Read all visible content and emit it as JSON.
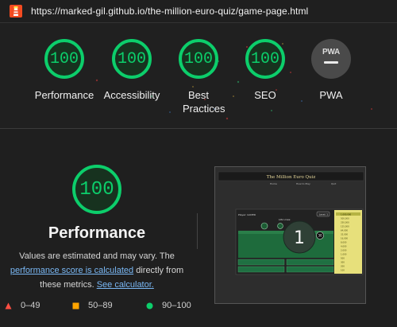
{
  "browser": {
    "url": "https://marked-gil.github.io/the-million-euro-quiz/game-page.html",
    "logo_icon": "lighthouse-icon"
  },
  "categories": [
    {
      "label": "Performance",
      "score": "100"
    },
    {
      "label": "Accessibility",
      "score": "100"
    },
    {
      "label": "Best Practices",
      "score": "100"
    },
    {
      "label": "SEO",
      "score": "100"
    },
    {
      "label": "PWA",
      "badge": "PWA",
      "icon": "pwa-badge-icon"
    }
  ],
  "detail": {
    "score": "100",
    "title": "Performance",
    "desc_prefix": "Values are estimated and may vary. The",
    "desc_link1": "performance score is calculated",
    "desc_middle": "directly from these metrics.",
    "desc_link2": "See calculator."
  },
  "legend": [
    {
      "range": "0–49",
      "color": "#ff4e42",
      "icon": "triangle-icon"
    },
    {
      "range": "50–89",
      "color": "#ffa400",
      "icon": "square-icon"
    },
    {
      "range": "90–100",
      "color": "#0cce6b",
      "icon": "circle-icon"
    }
  ],
  "screenshot": {
    "site_title": "The Million Euro Quiz",
    "nav": [
      "Home",
      "How to Play",
      "Quit"
    ],
    "player": "Player: GOVER",
    "lifelines": "Life Lines:",
    "level_badge": "Level: 1",
    "timer": "1",
    "score_small": "30",
    "prize_ladder": [
      "1,000,000",
      "500,000",
      "250,000",
      "125,000",
      "64,000",
      "32,000",
      "16,000",
      "8,000",
      "4,000",
      "2,000",
      "1,000",
      "500",
      "300",
      "200",
      "100"
    ]
  },
  "colors": {
    "pass": "#0cce6b",
    "pass_bg": "#17321f",
    "link": "#7ab8f5"
  }
}
